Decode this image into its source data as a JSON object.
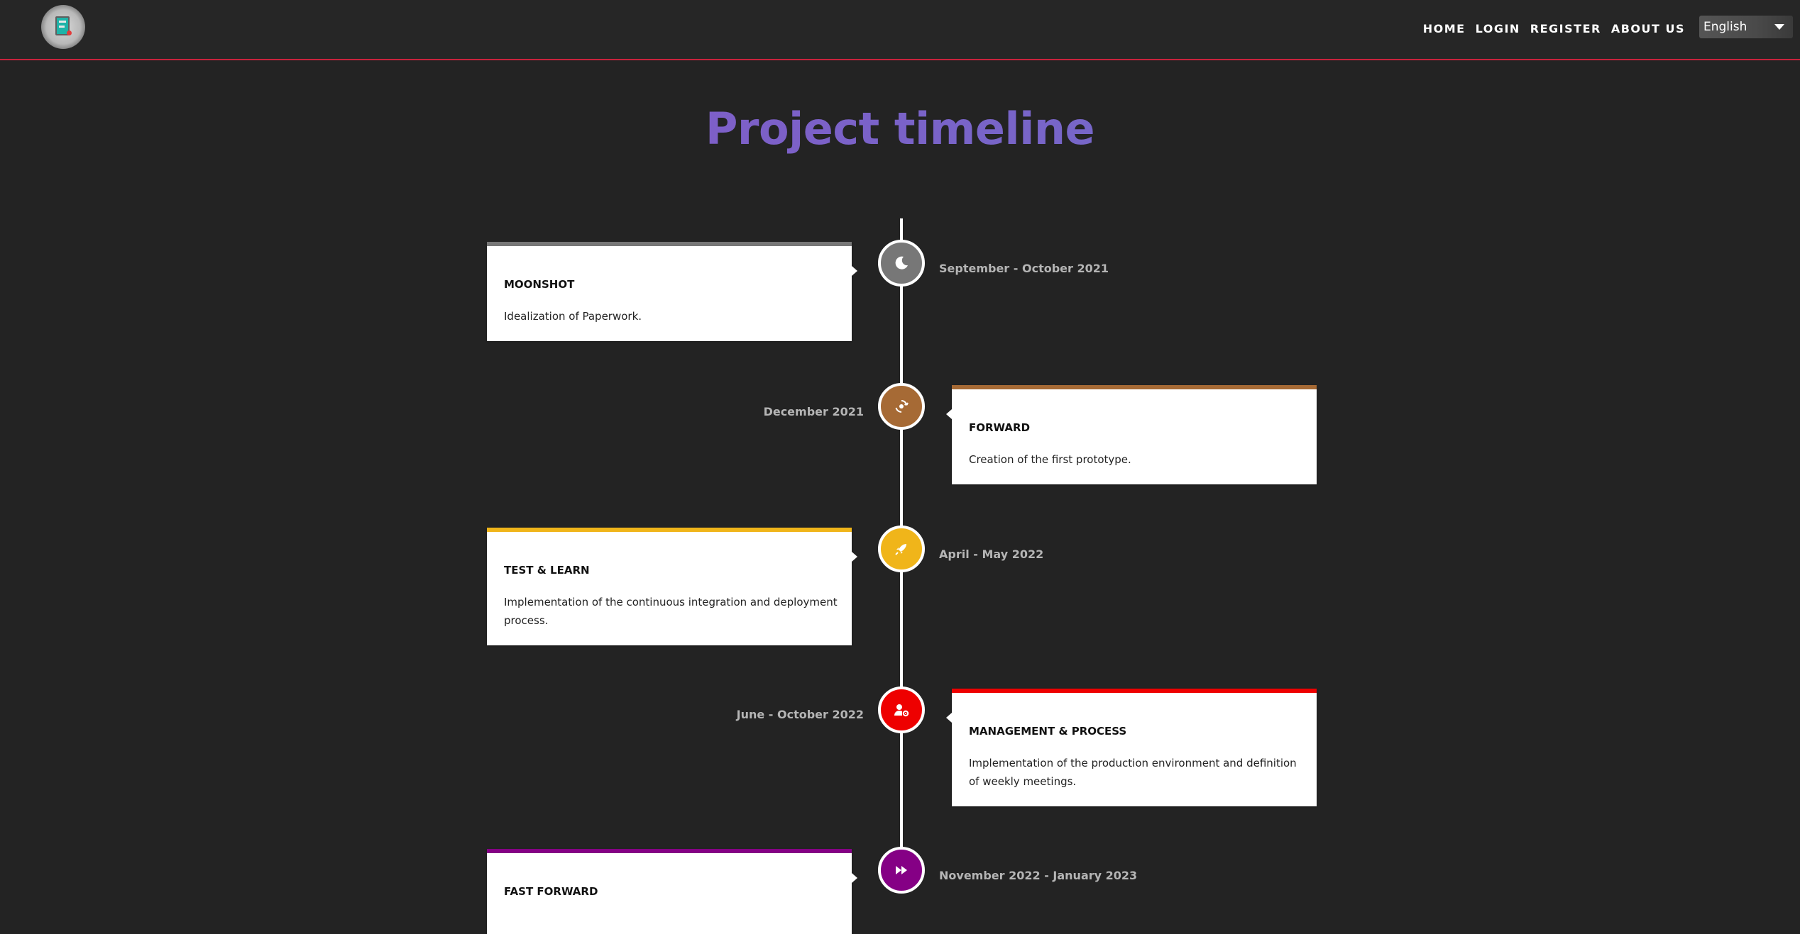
{
  "header": {
    "nav": [
      "HOME",
      "LOGIN",
      "REGISTER",
      "ABOUT US"
    ],
    "language": "English"
  },
  "page": {
    "title": "Project timeline"
  },
  "timeline": [
    {
      "title": "MOONSHOT",
      "description": "Idealization of Paperwork.",
      "date": "September - October 2021",
      "color": "#777777",
      "icon": "moon-icon"
    },
    {
      "title": "FORWARD",
      "description": "Creation of the first prototype.",
      "date": "December 2021",
      "color": "#a66a35",
      "icon": "refresh-target-icon"
    },
    {
      "title": "TEST & LEARN",
      "description": "Implementation of the continuous integration and deployment process.",
      "date": "April - May 2022",
      "color": "#f0b51a",
      "icon": "rocket-icon"
    },
    {
      "title": "MANAGEMENT & PROCESS",
      "description": "Implementation of the production environment and definition of weekly meetings.",
      "date": "June - October 2022",
      "color": "#ee0000",
      "icon": "user-gear-icon"
    },
    {
      "title": "FAST FORWARD",
      "description": "",
      "date": "November 2022 - January 2023",
      "color": "#850085",
      "icon": "fast-forward-icon"
    }
  ]
}
